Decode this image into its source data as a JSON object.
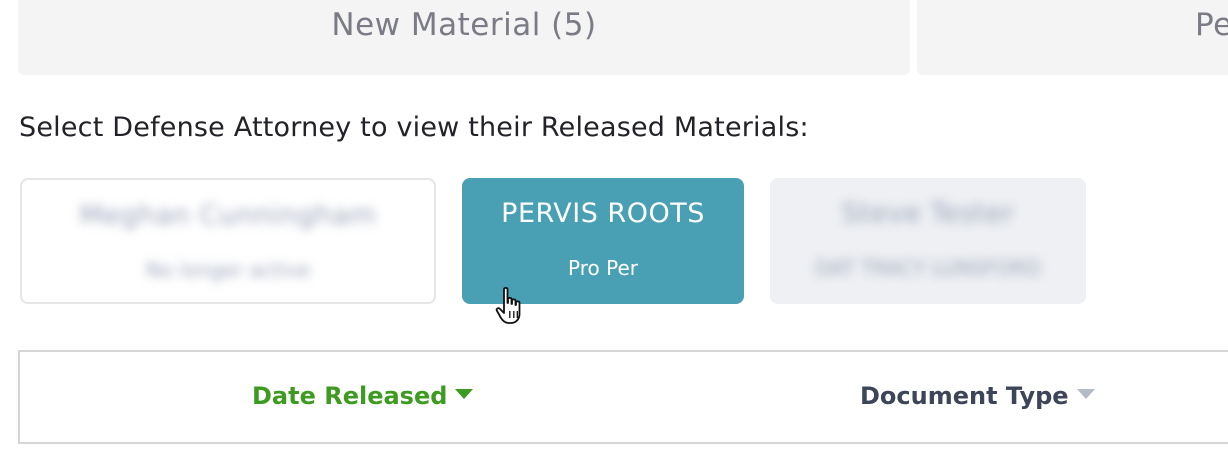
{
  "tabs": [
    {
      "label": "New Material (5)"
    },
    {
      "label": "Pe"
    }
  ],
  "prompt": "Select Defense Attorney to view their Released Materials:",
  "attorneys": [
    {
      "name": "Meghan Cunningham",
      "role": "No longer active",
      "selected": false,
      "blurred": true
    },
    {
      "name": "PERVIS ROOTS",
      "role": "Pro Per",
      "selected": true,
      "blurred": false
    },
    {
      "name": "Steve Tester",
      "role": "DAT TRACY LUNSFORD",
      "selected": false,
      "blurred": true
    }
  ],
  "table": {
    "columns": [
      {
        "label": "Date Released",
        "sort_active": true,
        "sort_icon": "caret-down-icon"
      },
      {
        "label": "Document Type",
        "sort_active": false,
        "sort_icon": "caret-down-icon"
      }
    ]
  },
  "colors": {
    "selected_attorney_bg": "#49a0b4",
    "active_sort": "#3d9b1f",
    "inactive_sort": "#b5bbc6",
    "tab_bg": "#f4f4f5"
  },
  "cursor_icon": "hand-pointer-icon"
}
